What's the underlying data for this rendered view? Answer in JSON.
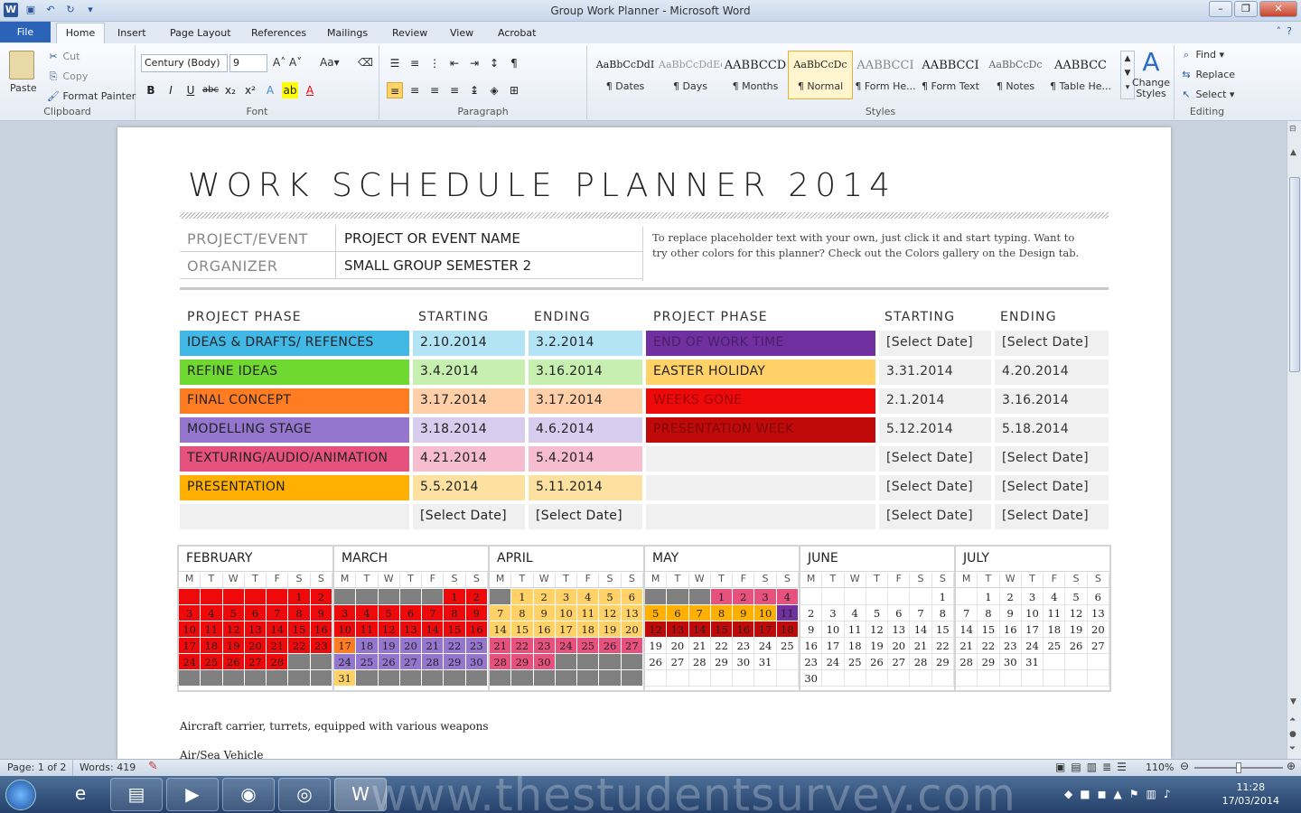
{
  "window": {
    "title": "Group Work Planner  -  Microsoft Word"
  },
  "tabs": [
    "File",
    "Home",
    "Insert",
    "Page Layout",
    "References",
    "Mailings",
    "Review",
    "View",
    "Acrobat"
  ],
  "clipboard": {
    "paste": "Paste",
    "cut": "Cut",
    "copy": "Copy",
    "format_painter": "Format Painter",
    "label": "Clipboard"
  },
  "font": {
    "name": "Century (Body)",
    "size": "9",
    "label": "Font"
  },
  "paragraph": {
    "label": "Paragraph"
  },
  "styles": {
    "label": "Styles",
    "items": [
      {
        "preview": "AaBbCcDdI",
        "name": "¶ Dates"
      },
      {
        "preview": "AaBbCcDdEe",
        "name": "¶ Days"
      },
      {
        "preview": "AABBCCD",
        "name": "¶ Months"
      },
      {
        "preview": "AaBbCcDc",
        "name": "¶ Normal"
      },
      {
        "preview": "AABBCCI",
        "name": "¶ Form He..."
      },
      {
        "preview": "AABBCCI",
        "name": "¶ Form Text"
      },
      {
        "preview": "AaBbCcDc",
        "name": "¶ Notes"
      },
      {
        "preview": "AABBCC",
        "name": "¶ Table He..."
      }
    ],
    "change": "Change Styles"
  },
  "editing": {
    "find": "Find",
    "replace": "Replace",
    "select": "Select",
    "label": "Editing"
  },
  "doc": {
    "title": "WORK SCHEDULE PLANNER 2014",
    "info": [
      {
        "label": "PROJECT/EVENT",
        "value": "PROJECT OR EVENT NAME"
      },
      {
        "label": "ORGANIZER",
        "value": "SMALL GROUP SEMESTER 2"
      }
    ],
    "note": "To replace placeholder text with your own, just click it and start typing. Want to try other colors for this planner? Check out the Colors gallery on the Design tab.",
    "headers": {
      "phase": "PROJECT PHASE",
      "start": "STARTING",
      "end": "ENDING"
    },
    "left_phases": [
      {
        "name": "IDEAS & DRAFTS/ REFENCES",
        "start": "2.10.2014",
        "end": "3.2.2014",
        "color": "#41b8e5",
        "light": "#b3e4f5"
      },
      {
        "name": "REFINE IDEAS",
        "start": "3.4.2014",
        "end": "3.16.2014",
        "color": "#6fd932",
        "light": "#c6efb0"
      },
      {
        "name": "FINAL CONCEPT",
        "start": "3.17.2014",
        "end": "3.17.2014",
        "color": "#ff7c22",
        "light": "#ffcfa8"
      },
      {
        "name": "MODELLING STAGE",
        "start": "3.18.2014",
        "end": "4.6.2014",
        "color": "#9576cf",
        "light": "#d9cdef"
      },
      {
        "name": "TEXTURING/AUDIO/ANIMATION",
        "start": "4.21.2014",
        "end": "5.4.2014",
        "color": "#e7517e",
        "light": "#f6bdd0"
      },
      {
        "name": "PRESENTATION",
        "start": "5.5.2014",
        "end": "5.11.2014",
        "color": "#ffb000",
        "light": "#fde1a0"
      },
      {
        "name": "",
        "start": "[Select Date]",
        "end": "[Select Date]",
        "color": "#f0f0f0",
        "light": "#f0f0f0"
      }
    ],
    "right_phases": [
      {
        "name": "END OF WORK TIME",
        "start": "[Select Date]",
        "end": "[Select Date]",
        "color": "#7030a0"
      },
      {
        "name": "EASTER HOLIDAY",
        "start": "3.31.2014",
        "end": "4.20.2014",
        "color": "#ffd166"
      },
      {
        "name": "WEEKS GONE",
        "start": "2.1.2014",
        "end": "3.16.2014",
        "color": "#ee0a0a"
      },
      {
        "name": "PRESENTATION WEEK",
        "start": "5.12.2014",
        "end": "5.18.2014",
        "color": "#c00a0a"
      },
      {
        "name": "",
        "start": "[Select Date]",
        "end": "[Select Date]",
        "color": "#f0f0f0"
      },
      {
        "name": "",
        "start": "[Select Date]",
        "end": "[Select Date]",
        "color": "#f0f0f0"
      },
      {
        "name": "",
        "start": "[Select Date]",
        "end": "[Select Date]",
        "color": "#f0f0f0"
      }
    ],
    "dows": [
      "M",
      "T",
      "W",
      "T",
      "F",
      "S",
      "S"
    ],
    "months": [
      {
        "name": "FEBRUARY",
        "weeks": [
          [
            "",
            "",
            "",
            "",
            "",
            "1",
            "2"
          ],
          [
            "3",
            "4",
            "5",
            "6",
            "7",
            "8",
            "9"
          ],
          [
            "10",
            "11",
            "12",
            "13",
            "14",
            "15",
            "16"
          ],
          [
            "17",
            "18",
            "19",
            "20",
            "21",
            "22",
            "23"
          ],
          [
            "24",
            "25",
            "26",
            "27",
            "28",
            "",
            ""
          ],
          [
            "",
            "",
            "",
            "",
            "",
            "",
            ""
          ]
        ],
        "colors": [
          [
            "R",
            "R",
            "R",
            "R",
            "R",
            "R",
            "R"
          ],
          [
            "R",
            "R",
            "R",
            "R",
            "R",
            "R",
            "R"
          ],
          [
            "R",
            "R",
            "R",
            "R",
            "R",
            "R",
            "R"
          ],
          [
            "R",
            "R",
            "R",
            "R",
            "R",
            "R",
            "R"
          ],
          [
            "R",
            "R",
            "R",
            "R",
            "R",
            "G",
            "G"
          ],
          [
            "G",
            "G",
            "G",
            "G",
            "G",
            "G",
            "G"
          ]
        ]
      },
      {
        "name": "MARCH",
        "weeks": [
          [
            "",
            "",
            "",
            "",
            "",
            "1",
            "2"
          ],
          [
            "3",
            "4",
            "5",
            "6",
            "7",
            "8",
            "9"
          ],
          [
            "10",
            "11",
            "12",
            "13",
            "14",
            "15",
            "16"
          ],
          [
            "17",
            "18",
            "19",
            "20",
            "21",
            "22",
            "23"
          ],
          [
            "24",
            "25",
            "26",
            "27",
            "28",
            "29",
            "30"
          ],
          [
            "31",
            "",
            "",
            "",
            "",
            "",
            ""
          ]
        ],
        "colors": [
          [
            "G",
            "G",
            "G",
            "G",
            "G",
            "R",
            "R"
          ],
          [
            "R",
            "R",
            "R",
            "R",
            "R",
            "R",
            "R"
          ],
          [
            "R",
            "R",
            "R",
            "R",
            "R",
            "R",
            "R"
          ],
          [
            "O",
            "P",
            "P",
            "P",
            "P",
            "P",
            "P"
          ],
          [
            "P",
            "P",
            "P",
            "P",
            "P",
            "P",
            "P"
          ],
          [
            "Y",
            "G",
            "G",
            "G",
            "G",
            "G",
            "G"
          ]
        ]
      },
      {
        "name": "APRIL",
        "weeks": [
          [
            "",
            "1",
            "2",
            "3",
            "4",
            "5",
            "6"
          ],
          [
            "7",
            "8",
            "9",
            "10",
            "11",
            "12",
            "13"
          ],
          [
            "14",
            "15",
            "16",
            "17",
            "18",
            "19",
            "20"
          ],
          [
            "21",
            "22",
            "23",
            "24",
            "25",
            "26",
            "27"
          ],
          [
            "28",
            "29",
            "30",
            "",
            "",
            "",
            ""
          ],
          [
            "",
            "",
            "",
            "",
            "",
            "",
            ""
          ]
        ],
        "colors": [
          [
            "G",
            "Y",
            "Y",
            "Y",
            "Y",
            "Y",
            "Y"
          ],
          [
            "Y",
            "Y",
            "Y",
            "Y",
            "Y",
            "Y",
            "Y"
          ],
          [
            "Y",
            "Y",
            "Y",
            "Y",
            "Y",
            "Y",
            "Y"
          ],
          [
            "K",
            "K",
            "K",
            "K",
            "K",
            "K",
            "K"
          ],
          [
            "K",
            "K",
            "K",
            "G",
            "G",
            "G",
            "G"
          ],
          [
            "G",
            "G",
            "G",
            "G",
            "G",
            "G",
            "G"
          ]
        ]
      },
      {
        "name": "MAY",
        "weeks": [
          [
            "",
            "",
            "",
            "1",
            "2",
            "3",
            "4"
          ],
          [
            "5",
            "6",
            "7",
            "8",
            "9",
            "10",
            "11"
          ],
          [
            "12",
            "13",
            "14",
            "15",
            "16",
            "17",
            "18"
          ],
          [
            "19",
            "20",
            "21",
            "22",
            "23",
            "24",
            "25"
          ],
          [
            "26",
            "27",
            "28",
            "29",
            "30",
            "31",
            ""
          ],
          [
            "",
            "",
            "",
            "",
            "",
            "",
            ""
          ]
        ],
        "colors": [
          [
            "G",
            "G",
            "G",
            "K",
            "K",
            "K",
            "K"
          ],
          [
            "A",
            "A",
            "A",
            "A",
            "A",
            "A",
            "V"
          ],
          [
            "D",
            "D",
            "D",
            "D",
            "D",
            "D",
            "D"
          ],
          [
            "W",
            "W",
            "W",
            "W",
            "W",
            "W",
            "W"
          ],
          [
            "W",
            "W",
            "W",
            "W",
            "W",
            "W",
            "W"
          ],
          [
            "W",
            "W",
            "W",
            "W",
            "W",
            "W",
            "W"
          ]
        ]
      },
      {
        "name": "JUNE",
        "weeks": [
          [
            "",
            "",
            "",
            "",
            "",
            "",
            "1"
          ],
          [
            "2",
            "3",
            "4",
            "5",
            "6",
            "7",
            "8"
          ],
          [
            "9",
            "10",
            "11",
            "12",
            "13",
            "14",
            "15"
          ],
          [
            "16",
            "17",
            "18",
            "19",
            "20",
            "21",
            "22"
          ],
          [
            "23",
            "24",
            "25",
            "26",
            "27",
            "28",
            "29"
          ],
          [
            "30",
            "",
            "",
            "",
            "",
            "",
            ""
          ]
        ],
        "colors": [
          [
            "W",
            "W",
            "W",
            "W",
            "W",
            "W",
            "W"
          ],
          [
            "W",
            "W",
            "W",
            "W",
            "W",
            "W",
            "W"
          ],
          [
            "W",
            "W",
            "W",
            "W",
            "W",
            "W",
            "W"
          ],
          [
            "W",
            "W",
            "W",
            "W",
            "W",
            "W",
            "W"
          ],
          [
            "W",
            "W",
            "W",
            "W",
            "W",
            "W",
            "W"
          ],
          [
            "W",
            "W",
            "W",
            "W",
            "W",
            "W",
            "W"
          ]
        ]
      },
      {
        "name": "JULY",
        "weeks": [
          [
            "",
            "1",
            "2",
            "3",
            "4",
            "5",
            "6"
          ],
          [
            "7",
            "8",
            "9",
            "10",
            "11",
            "12",
            "13"
          ],
          [
            "14",
            "15",
            "16",
            "17",
            "18",
            "19",
            "20"
          ],
          [
            "21",
            "22",
            "23",
            "24",
            "25",
            "26",
            "27"
          ],
          [
            "28",
            "29",
            "30",
            "31",
            "",
            "",
            ""
          ],
          [
            "",
            "",
            "",
            "",
            "",
            "",
            ""
          ]
        ],
        "colors": [
          [
            "W",
            "W",
            "W",
            "W",
            "W",
            "W",
            "W"
          ],
          [
            "W",
            "W",
            "W",
            "W",
            "W",
            "W",
            "W"
          ],
          [
            "W",
            "W",
            "W",
            "W",
            "W",
            "W",
            "W"
          ],
          [
            "W",
            "W",
            "W",
            "W",
            "W",
            "W",
            "W"
          ],
          [
            "W",
            "W",
            "W",
            "W",
            "W",
            "W",
            "W"
          ],
          [
            "W",
            "W",
            "W",
            "W",
            "W",
            "W",
            "W"
          ]
        ]
      }
    ],
    "palette": {
      "R": "#ee0a0a",
      "G": "#808080",
      "O": "#ff7c22",
      "P": "#9576cf",
      "Y": "#ffd166",
      "K": "#e7517e",
      "A": "#ffb000",
      "V": "#7030a0",
      "D": "#c00a0a",
      "W": "#ffffff"
    },
    "body": [
      "Aircraft carrier, turrets, equipped with various weapons",
      "Air/Sea Vehicle"
    ]
  },
  "status": {
    "page": "Page: 1 of 2",
    "words": "Words: 419",
    "zoom": "110%"
  },
  "taskbar": {
    "time": "11:28",
    "date": "17/03/2014",
    "watermark": "www.thestudentsurvey.com"
  }
}
